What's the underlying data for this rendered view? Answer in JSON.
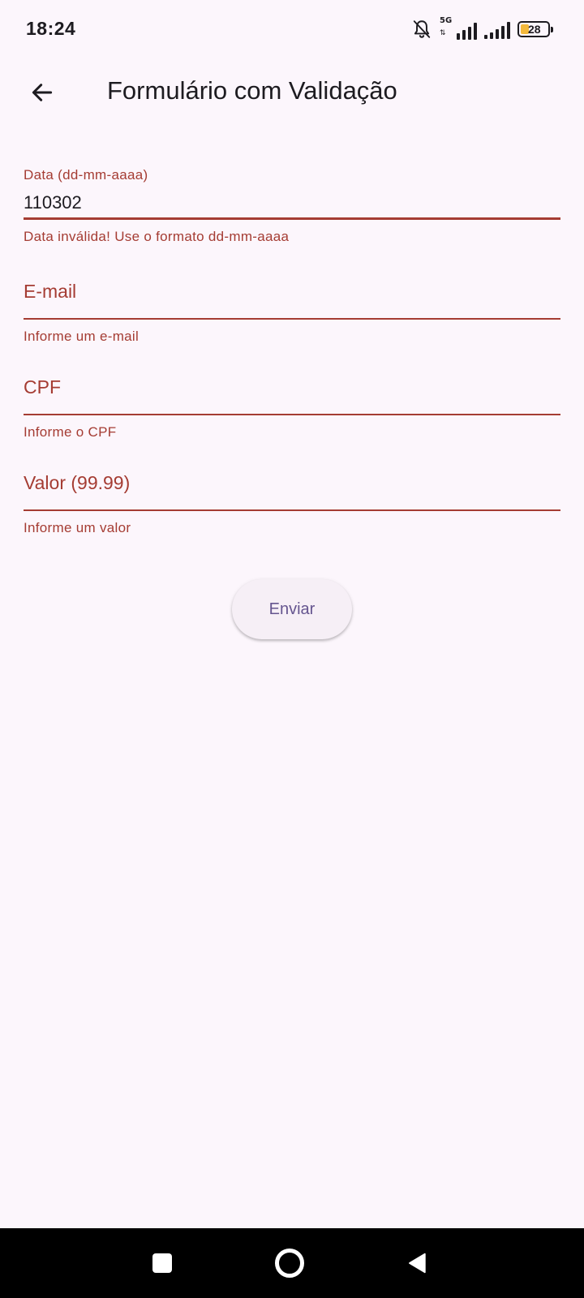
{
  "status_bar": {
    "time": "18:24",
    "network_label": "5G",
    "network_arrows": "⇅",
    "battery_level": "28",
    "battery_color": "#f4b93c",
    "icons": [
      "bell-muted-icon",
      "signal-5g-icon",
      "signal-icon",
      "battery-icon"
    ]
  },
  "app_bar": {
    "title": "Formulário com Validação",
    "back_icon": "arrow-left-icon"
  },
  "form": {
    "date": {
      "label": "Data (dd-mm-aaaa)",
      "value": "110302",
      "error": "Data inválida! Use o formato dd-mm-aaaa"
    },
    "email": {
      "placeholder": "E-mail",
      "error": "Informe um e-mail"
    },
    "cpf": {
      "placeholder": "CPF",
      "error": "Informe o CPF"
    },
    "valor": {
      "placeholder": "Valor (99.99)",
      "error": "Informe um valor"
    },
    "submit_label": "Enviar"
  },
  "colors": {
    "error": "#a53c33",
    "background": "#fcf6fc",
    "button_text": "#65558f"
  },
  "nav_bar": {
    "icons": [
      "recents-square-icon",
      "home-circle-icon",
      "back-triangle-icon"
    ]
  }
}
